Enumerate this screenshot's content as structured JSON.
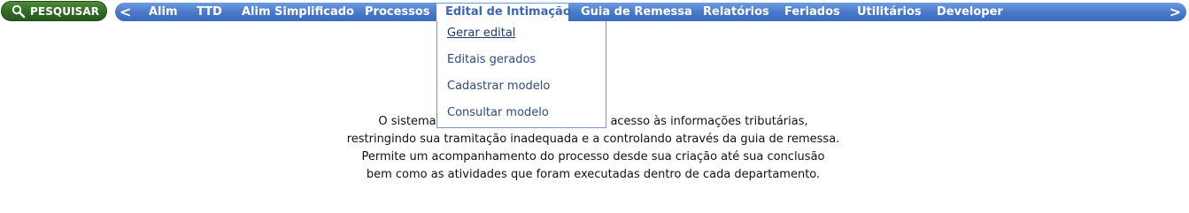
{
  "search": {
    "label": "PESQUISAR"
  },
  "menubar": {
    "prev_arrow": "<",
    "next_arrow": ">",
    "items": [
      {
        "label": "Alim"
      },
      {
        "label": "TTD"
      },
      {
        "label": "Alim Simplificado"
      },
      {
        "label": "Processos"
      },
      {
        "label": "Edital de Intimação",
        "active": true
      },
      {
        "label": "Guia de Remessa"
      },
      {
        "label": "Relatórios"
      },
      {
        "label": "Feriados"
      },
      {
        "label": "Utilitários"
      },
      {
        "label": "Developer"
      }
    ]
  },
  "dropdown": {
    "items": [
      {
        "label": "Gerar edital"
      },
      {
        "label": "Editais gerados"
      },
      {
        "label": "Cadastrar modelo"
      },
      {
        "label": "Consultar modelo"
      }
    ]
  },
  "description": {
    "lines": [
      "O sistema Co                                   fácil acesso às informações tributárias,",
      "restringindo sua tramitação inadequada e a controlando através da guia de remessa.",
      "Permite um acompanhamento do processo desde sua criação até sua conclusão",
      "bem como as atividades que foram executadas dentro de cada departamento."
    ]
  },
  "colors": {
    "search_green": "#2f6a23",
    "menu_blue": "#4778c9",
    "active_text": "#3a67b8",
    "dropdown_text": "#2d4a80"
  }
}
